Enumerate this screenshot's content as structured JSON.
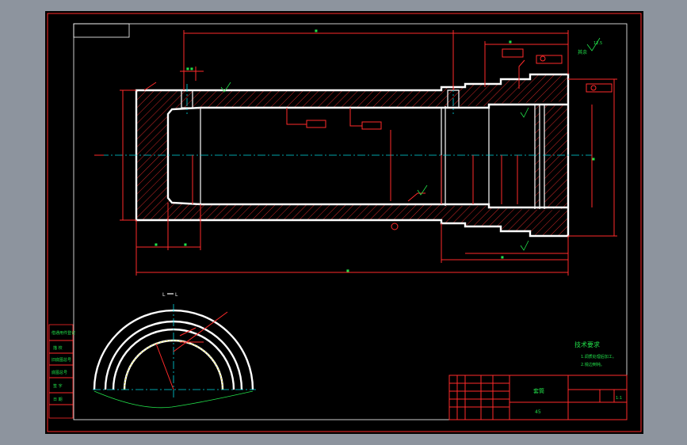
{
  "colors": {
    "background": "#8d949e",
    "sheet": "#000000",
    "border": "#ff2a2a",
    "outline": "#ffffff",
    "centerline": "#00d8e0",
    "annotation": "#22e04a"
  },
  "section_label": {
    "left": "L",
    "right": "L"
  },
  "roughness_note": {
    "value": "12.5",
    "suffix": "其余"
  },
  "tech_requirements": {
    "title": "技术要求",
    "item1": "1.调质处理后加工。",
    "item2": "2.锐边倒钝。"
  },
  "title_block": {
    "part_name": "套筒",
    "material": "45",
    "scale": "1:1"
  },
  "side_column": {
    "items": [
      "借通用件登记",
      "描 校",
      "旧底图总号",
      "底图总号",
      "签 字",
      "日 期"
    ]
  }
}
